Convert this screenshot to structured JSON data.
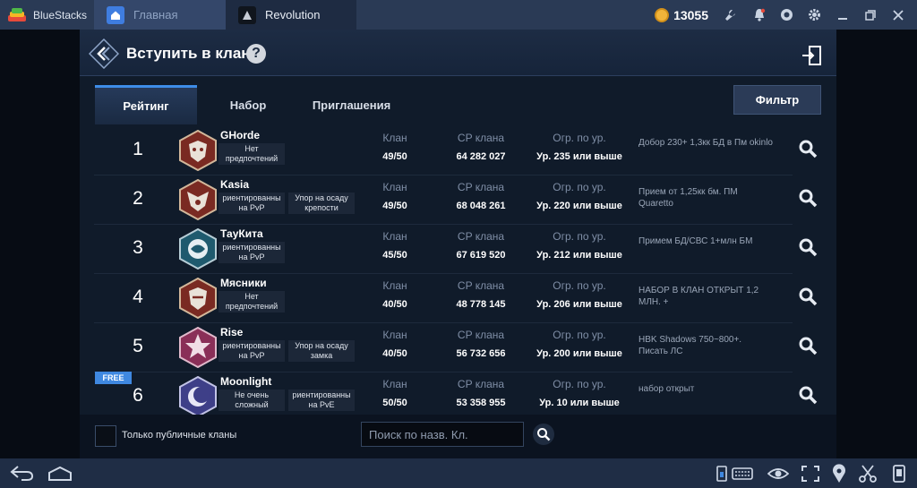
{
  "titlebar": {
    "app_name": "BlueStacks",
    "tabs": [
      {
        "label": "Главная"
      },
      {
        "label": "Revolution"
      }
    ],
    "coins": "13055",
    "icons": [
      "wrench-icon",
      "bell-icon",
      "account-icon",
      "gear-icon",
      "minimize-icon",
      "restore-icon",
      "close-icon"
    ]
  },
  "panel": {
    "title": "Вступить в клан",
    "help": "?",
    "tabs": [
      {
        "label": "Рейтинг",
        "active": true
      },
      {
        "label": "Набор",
        "active": false
      },
      {
        "label": "Приглашения",
        "active": false
      }
    ],
    "filter_label": "Фильтр",
    "columns": {
      "clan": "Клан",
      "cp": "CP клана",
      "level": "Огр. по ур."
    },
    "clans": [
      {
        "rank": "1",
        "name": "GHorde",
        "tags": [
          "Нет предпочтений"
        ],
        "members": "49/50",
        "cp": "64 282 027",
        "level": "Ур. 235 или выше",
        "desc": "Добор 230+ 1,3кк  БД в Пм okinlo",
        "emblem_color": "#7a2a22"
      },
      {
        "rank": "2",
        "name": "Kasia",
        "tags": [
          "риентированны на PvP",
          "Упор на осаду крепости"
        ],
        "members": "49/50",
        "cp": "68 048 261",
        "level": "Ур. 220 или выше",
        "desc": "Прием от 1,25кк бм. ПМ Quaretto",
        "emblem_color": "#7a2a22"
      },
      {
        "rank": "3",
        "name": "ТауКита",
        "tags": [
          "риентированны на PvP"
        ],
        "members": "45/50",
        "cp": "67 619 520",
        "level": "Ур. 212 или выше",
        "desc": "Примем БД/СВС 1+млн БМ",
        "emblem_color": "#1f5a6e"
      },
      {
        "rank": "4",
        "name": "Мясники",
        "tags": [
          "Нет предпочтений"
        ],
        "members": "40/50",
        "cp": "48 778 145",
        "level": "Ур. 206 или выше",
        "desc": "НАБОР В КЛАН ОТКРЫТ 1,2 МЛН. +",
        "emblem_color": "#7a2a22"
      },
      {
        "rank": "5",
        "name": "Rise",
        "tags": [
          "риентированны на PvP",
          "Упор на осаду замка"
        ],
        "members": "40/50",
        "cp": "56 732 656",
        "level": "Ур. 200 или выше",
        "desc": "HBK Shadows 750~800+. Писать ЛС",
        "emblem_color": "#8a2f58"
      },
      {
        "rank": "6",
        "name": "Moonlight",
        "tags": [
          "Не очень сложный",
          "риентированны на PvE"
        ],
        "members": "50/50",
        "cp": "53 358 955",
        "level": "Ур. 10 или выше",
        "desc": "набор открыт",
        "emblem_color": "#3e3f88"
      }
    ],
    "free_badge": "FREE",
    "public_only_label": "Только публичные кланы",
    "search_placeholder": "Поиск по назв. Кл."
  }
}
